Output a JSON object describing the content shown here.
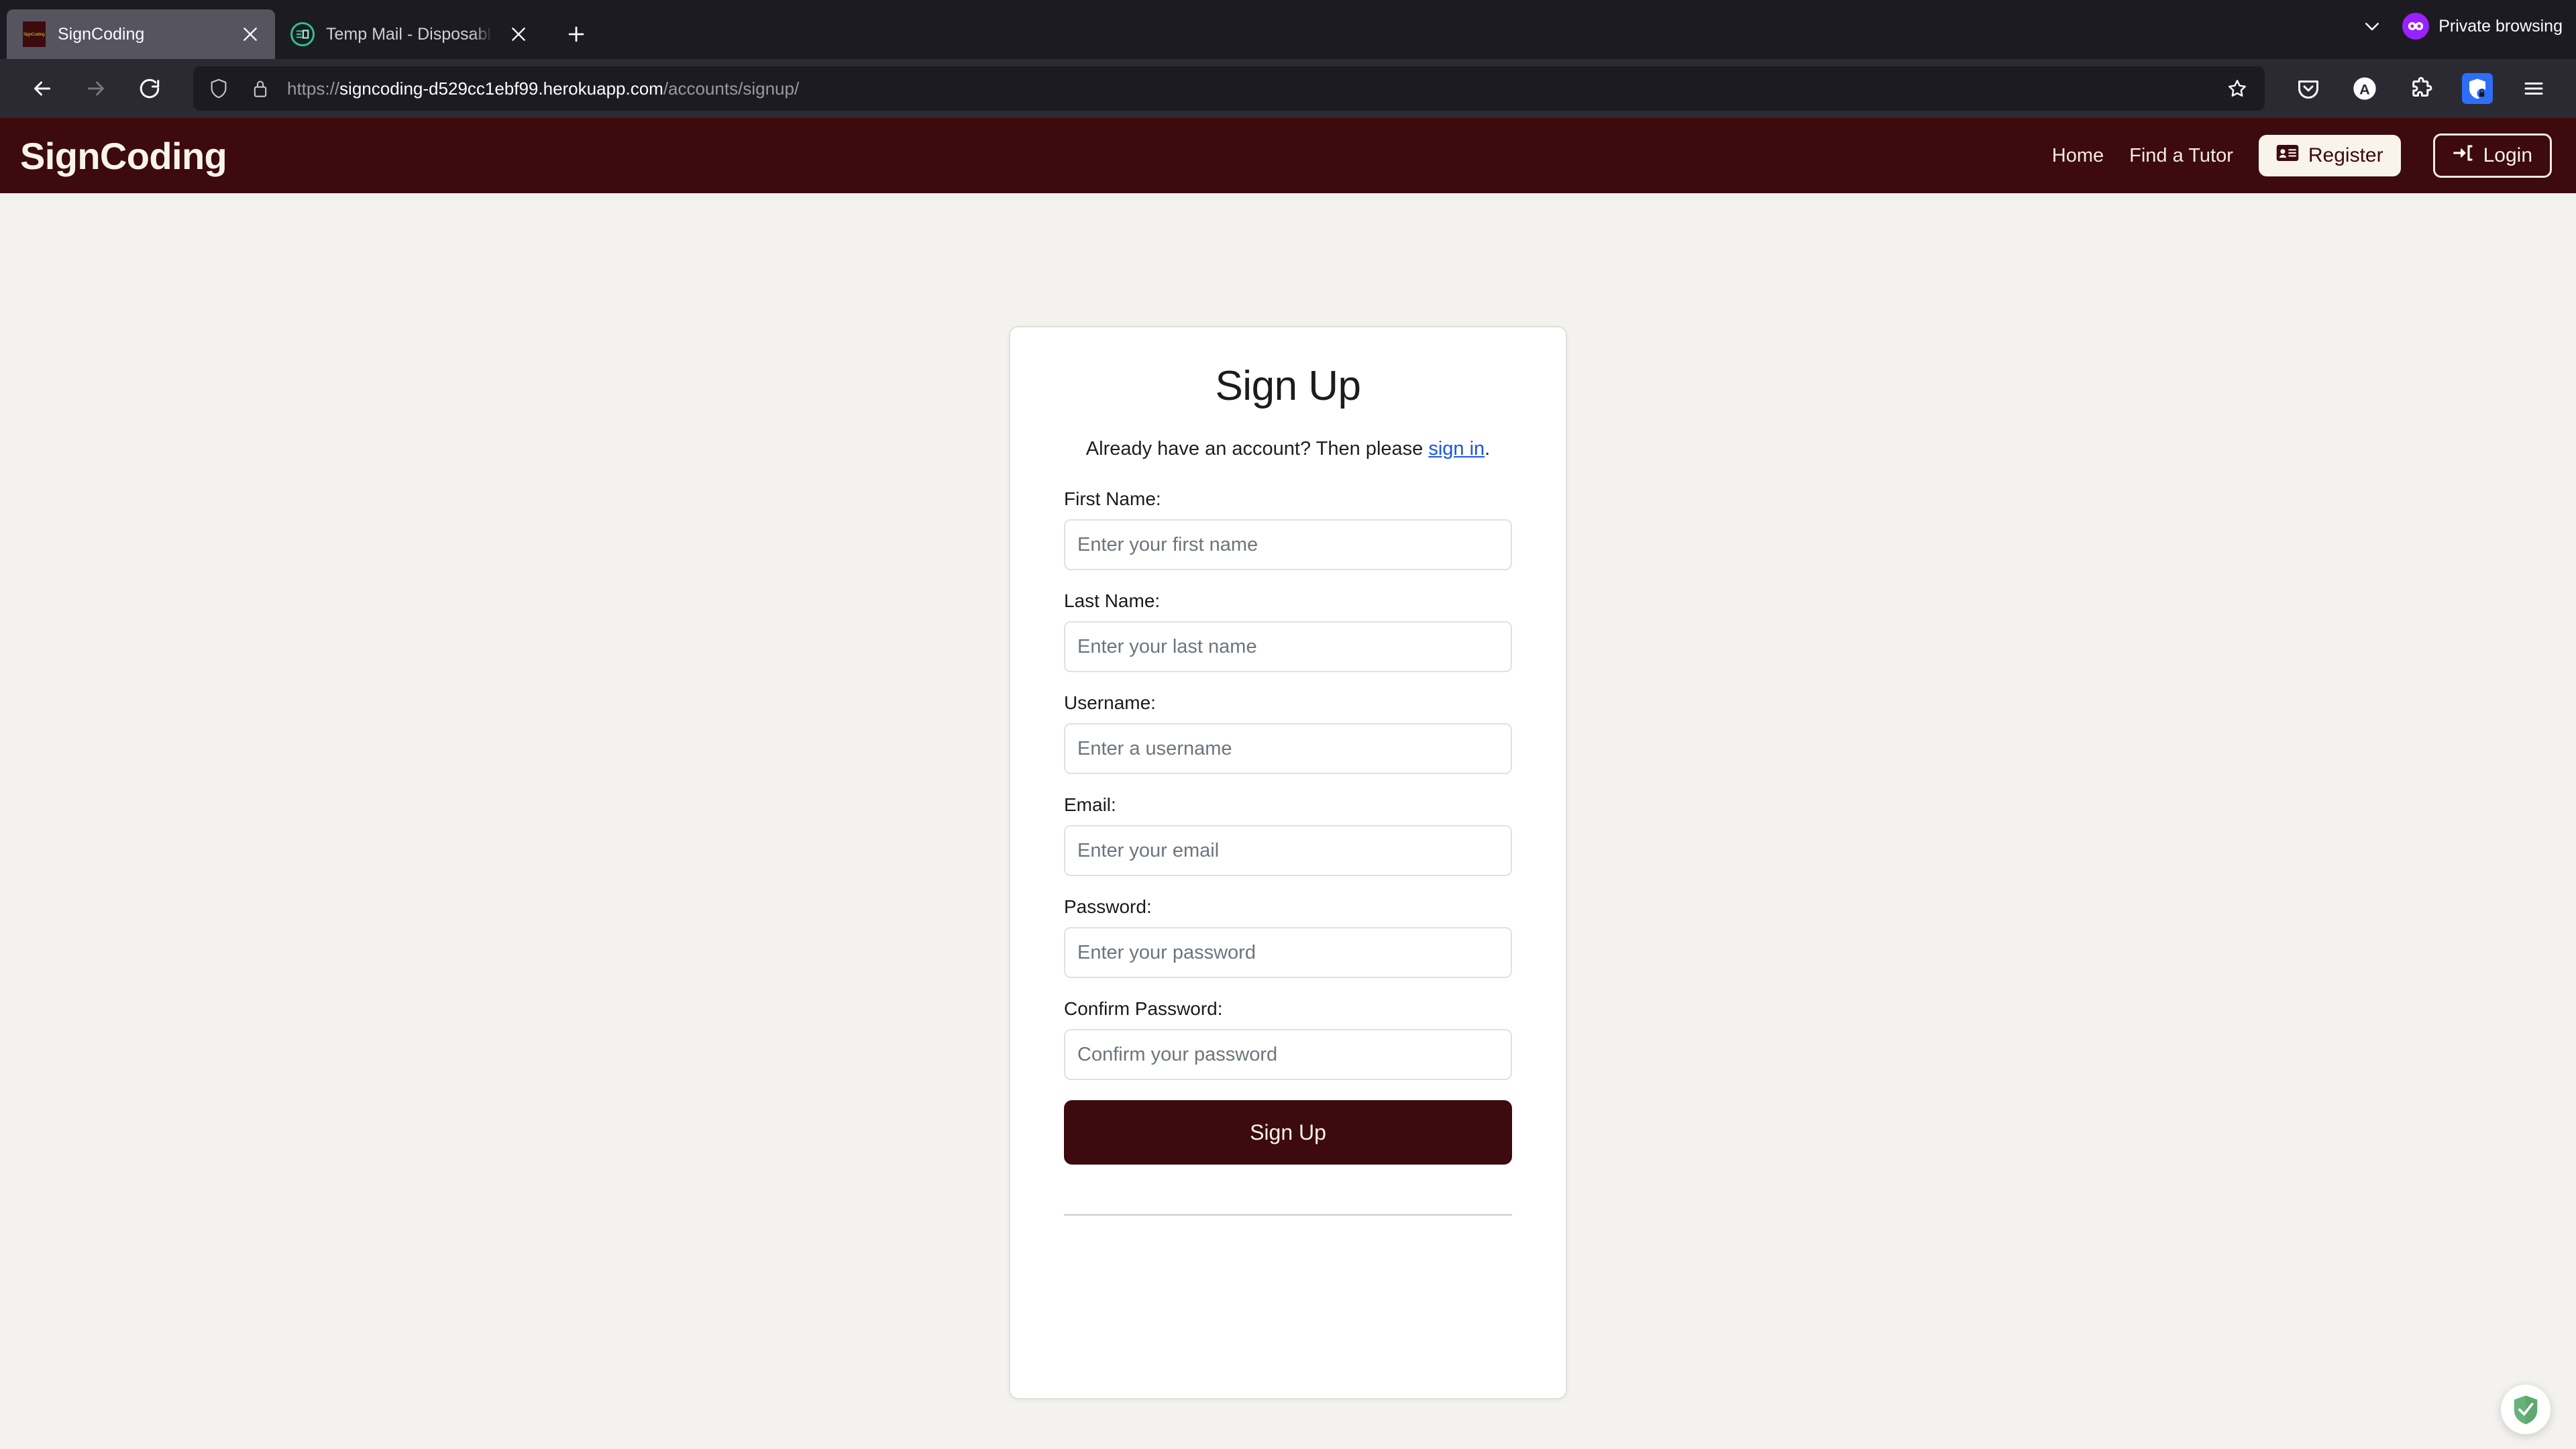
{
  "browser": {
    "tabs": [
      {
        "title": "SignCoding",
        "favicon": "signcoding-favicon",
        "active": true,
        "close_label": "✕"
      },
      {
        "title": "Temp Mail - Disposable Tempora",
        "favicon": "tempmail-favicon",
        "active": false,
        "close_label": "✕"
      }
    ],
    "new_tab_label": "+",
    "private_browsing_label": "Private browsing",
    "nav": {
      "back_label": "Back",
      "forward_label": "Forward",
      "reload_label": "Reload"
    },
    "url": {
      "scheme": "https://",
      "host": "signcoding-d529cc1ebf99.herokuapp.com",
      "path": "/accounts/signup/",
      "full": "https://signcoding-d529cc1ebf99.herokuapp.com/accounts/signup/"
    },
    "toolbar_icons": [
      "pocket-icon",
      "account-icon",
      "extensions-icon",
      "adguard-extension-icon",
      "app-menu-icon"
    ],
    "bookmark_label": "Bookmark this page"
  },
  "site": {
    "brand": "SignCoding",
    "nav_links": [
      {
        "label": "Home"
      },
      {
        "label": "Find a Tutor"
      }
    ],
    "register_label": "Register",
    "login_label": "Login",
    "colors": {
      "header_bg": "#3d0a0e",
      "header_text": "#f8f4ec",
      "page_bg": "#f4f2ef",
      "link": "#1a56db"
    }
  },
  "signup": {
    "title": "Sign Up",
    "subtitle_before": "Already have an account? Then please ",
    "subtitle_link": "sign in",
    "subtitle_after": ".",
    "fields": [
      {
        "label": "First Name:",
        "placeholder": "Enter your first name",
        "value": "",
        "type": "text",
        "name": "first-name"
      },
      {
        "label": "Last Name:",
        "placeholder": "Enter your last name",
        "value": "",
        "type": "text",
        "name": "last-name"
      },
      {
        "label": "Username:",
        "placeholder": "Enter a username",
        "value": "",
        "type": "text",
        "name": "username"
      },
      {
        "label": "Email:",
        "placeholder": "Enter your email",
        "value": "",
        "type": "email",
        "name": "email"
      },
      {
        "label": "Password:",
        "placeholder": "Enter your password",
        "value": "",
        "type": "password",
        "name": "password"
      },
      {
        "label": "Confirm Password:",
        "placeholder": "Confirm your password",
        "value": "",
        "type": "password",
        "name": "confirm-password"
      }
    ],
    "submit_label": "Sign Up"
  },
  "overlay": {
    "adguard_label": "AdGuard Assistant"
  }
}
